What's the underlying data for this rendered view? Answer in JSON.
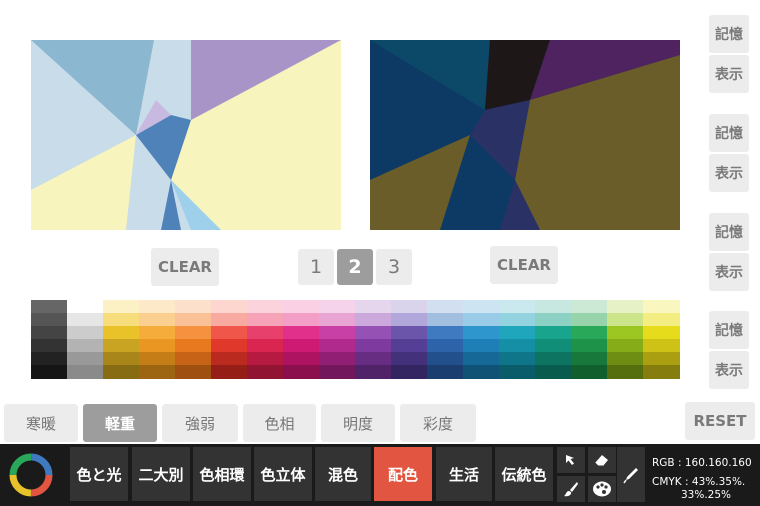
{
  "side_buttons": [
    "記憶",
    "表示",
    "記憶",
    "表示",
    "記憶",
    "表示",
    "記憶",
    "表示"
  ],
  "clear_labels": {
    "left": "CLEAR",
    "right": "CLEAR"
  },
  "pages": [
    "1",
    "2",
    "3"
  ],
  "selected_page": "2",
  "tabs": [
    "寒暖",
    "軽重",
    "強弱",
    "色相",
    "明度",
    "彩度"
  ],
  "selected_tab": "軽重",
  "reset_label": "RESET",
  "toolbar": {
    "buttons": [
      "色と光",
      "二大別",
      "色相環",
      "色立体",
      "混色",
      "配色",
      "生活",
      "伝統色"
    ],
    "active": "配色",
    "tool_icons": [
      "pointer-icon",
      "eraser-icon",
      "brush-icon",
      "palette-icon",
      "pen-icon"
    ],
    "rgb_line": "RGB : 160.160.160",
    "cmyk_line1": "CMYK : 43%.35%.",
    "cmyk_line2": "33%.25%"
  },
  "colors": {
    "accent": "#e25641",
    "light_composition": [
      "#c9dce9",
      "#8cb7d1",
      "#f8f4bd",
      "#a894c7",
      "#4f82b8",
      "#9ed0ec",
      "#c7b9e0"
    ],
    "dark_composition": [
      "#0d3a64",
      "#6b5d29",
      "#0c4868",
      "#1e1717",
      "#4f2260",
      "#2a3165"
    ],
    "palette_columns": [
      [
        "#666666",
        "#555555",
        "#444444",
        "#333333",
        "#222222",
        "#151515"
      ],
      [
        "#ffffff",
        "#e6e6e6",
        "#cccccc",
        "#b3b3b3",
        "#999999",
        "#8a8a8a"
      ],
      [
        "#fcf1c4",
        "#f7dd7c",
        "#e9c229",
        "#c9a322",
        "#a8861a",
        "#876c14"
      ],
      [
        "#fde8c8",
        "#fbcf8f",
        "#f6ac3b",
        "#e99722",
        "#c57d18",
        "#9d6412"
      ],
      [
        "#fde0cb",
        "#fbc196",
        "#f6923f",
        "#e9791f",
        "#c66316",
        "#9f4f10"
      ],
      [
        "#fcd6cf",
        "#f9aaa0",
        "#f0574a",
        "#e0392c",
        "#bb2a1f",
        "#951f17"
      ],
      [
        "#fbd3dc",
        "#f6a3b8",
        "#e8406c",
        "#d9254f",
        "#b61a40",
        "#911432"
      ],
      [
        "#f9d0e4",
        "#f29ec7",
        "#e0308b",
        "#cf1a74",
        "#ad1360",
        "#8a0f4c"
      ],
      [
        "#f5d3ea",
        "#e8a5d3",
        "#c83fa6",
        "#b02a8e",
        "#911f74",
        "#73175c"
      ],
      [
        "#e6d6ed",
        "#cba9dc",
        "#9552b4",
        "#7e3a9e",
        "#672d83",
        "#502267"
      ],
      [
        "#d9d4ec",
        "#b2a7da",
        "#6a55ab",
        "#553f96",
        "#43317b",
        "#332561"
      ],
      [
        "#d2dff0",
        "#a3bfe0",
        "#3f79c0",
        "#2c63a9",
        "#22508c",
        "#193e6f"
      ],
      [
        "#cde5f3",
        "#9bcce7",
        "#2e95cd",
        "#1d7fb6",
        "#166896",
        "#105276"
      ],
      [
        "#c9e9ef",
        "#93d3df",
        "#1fa6bd",
        "#148fa6",
        "#0f7588",
        "#0b5c6b"
      ],
      [
        "#c6e8e1",
        "#8cd1c3",
        "#19a58d",
        "#118e77",
        "#0d7462",
        "#095b4d"
      ],
      [
        "#cbe9d5",
        "#97d3ab",
        "#2aa85a",
        "#1e9249",
        "#18783b",
        "#125f2e"
      ],
      [
        "#e6f2c5",
        "#cde58a",
        "#9cc621",
        "#86ad18",
        "#6e8e13",
        "#566f0e"
      ],
      [
        "#f9f6c0",
        "#f3ed82",
        "#e7dc1c",
        "#cdc215",
        "#a99f11",
        "#857d0d"
      ]
    ]
  }
}
